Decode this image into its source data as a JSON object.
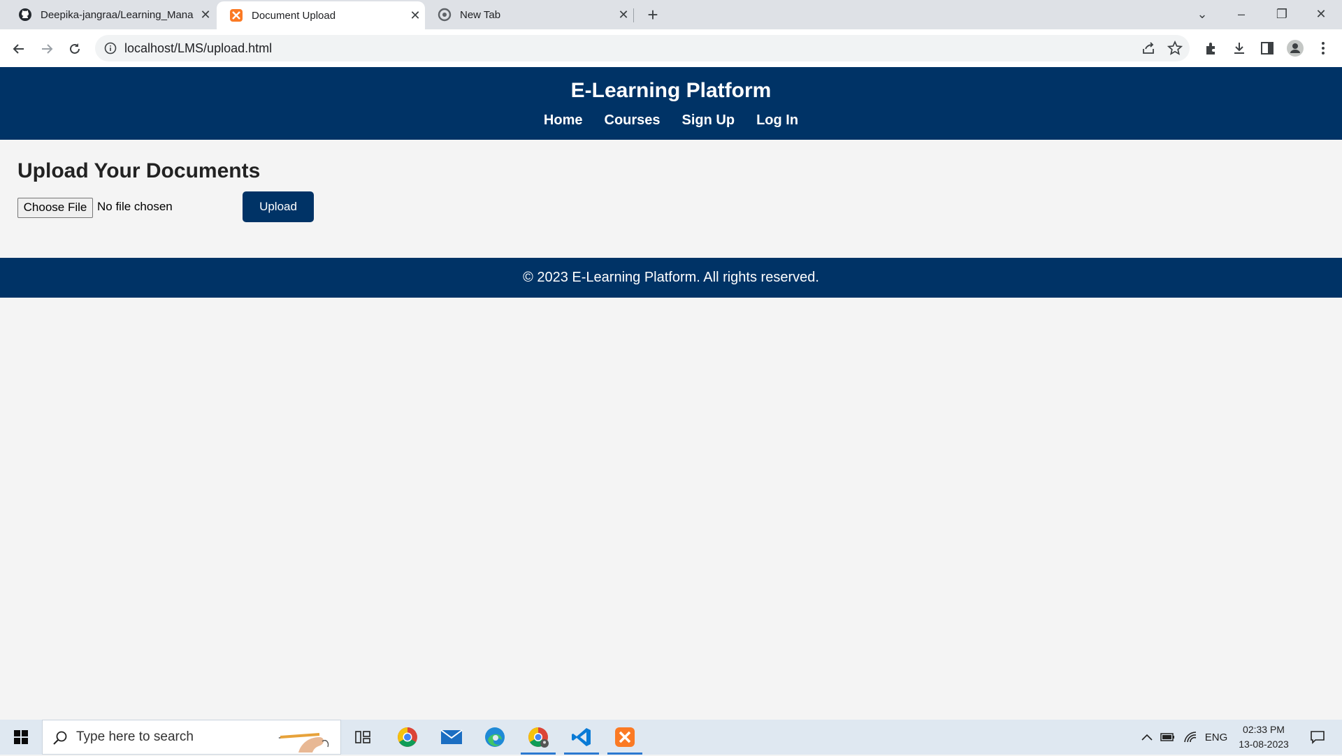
{
  "browser": {
    "tabs": [
      {
        "title": "Deepika-jangraa/Learning_Mana",
        "icon": "github-icon",
        "active": false
      },
      {
        "title": "Document Upload",
        "icon": "xampp-icon",
        "active": true
      },
      {
        "title": "New Tab",
        "icon": "chrome-icon",
        "active": false
      }
    ],
    "url": "localhost/LMS/upload.html"
  },
  "site": {
    "title": "E-Learning Platform",
    "nav": [
      "Home",
      "Courses",
      "Sign Up",
      "Log In"
    ],
    "heading": "Upload Your Documents",
    "file_button_label": "Choose File",
    "file_status": "No file chosen",
    "upload_label": "Upload",
    "footer": "© 2023 E-Learning Platform. All rights reserved.",
    "colors": {
      "primary": "#003366",
      "background": "#f4f4f4"
    }
  },
  "taskbar": {
    "search_placeholder": "Type here to search",
    "language": "ENG",
    "time": "02:33 PM",
    "date": "13-08-2023",
    "apps": [
      "task-view-icon",
      "chrome-icon",
      "mail-icon",
      "edge-icon",
      "chrome-profile-icon",
      "vscode-icon",
      "xampp-icon"
    ]
  }
}
